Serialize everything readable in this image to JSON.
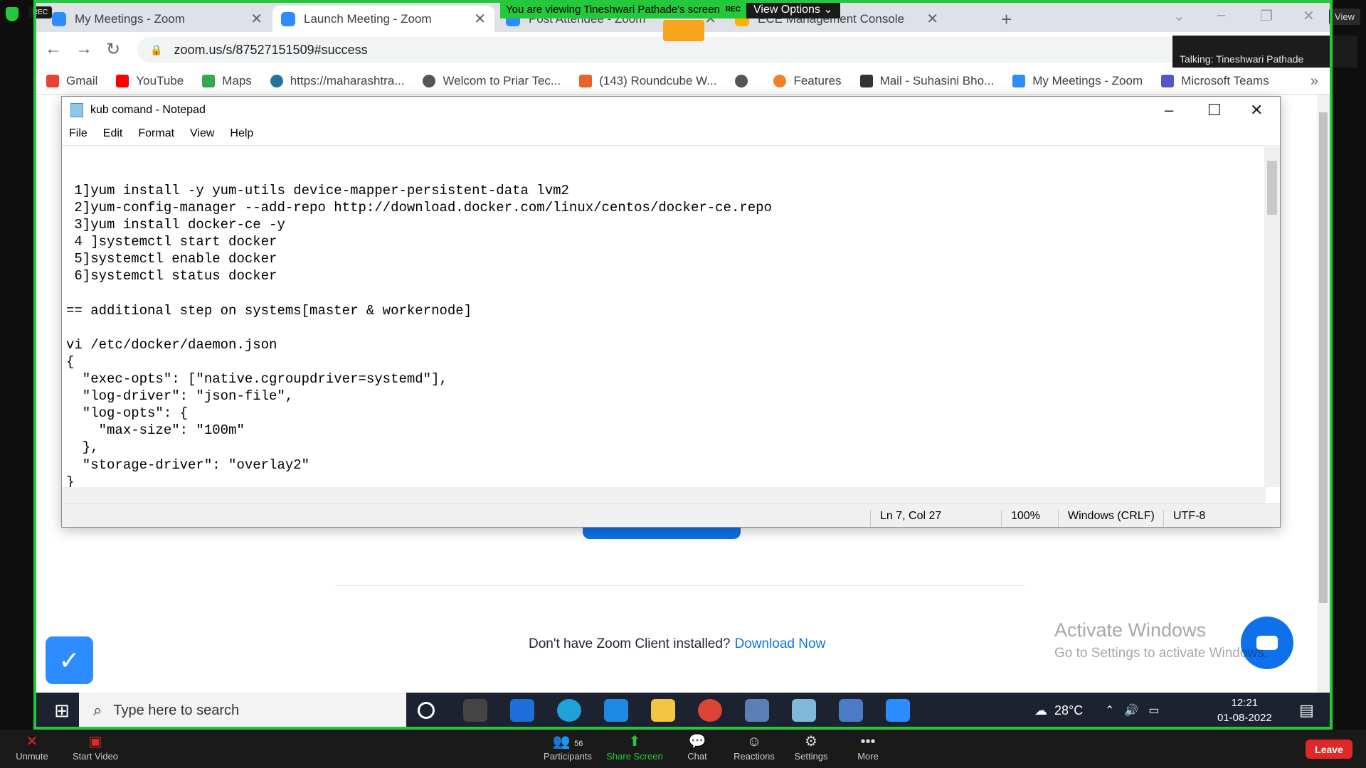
{
  "zoom_share": {
    "banner_text": "You are viewing Tineshwari Pathade's screen",
    "rec_label": "REC",
    "view_options_label": "View Options ⌄",
    "talking_text": "Talking: Tineshwari Pathade",
    "view_label": "View"
  },
  "browser": {
    "tabs": [
      {
        "title": "My Meetings - Zoom",
        "active": false
      },
      {
        "title": "Launch Meeting - Zoom",
        "active": true
      },
      {
        "title": "Post Attendee - Zoom",
        "active": false
      },
      {
        "title": "ECE Management Console",
        "active": false
      }
    ],
    "url": "zoom.us/s/87527151509#success",
    "bookmarks": [
      {
        "label": "Gmail",
        "color": "#ea4335"
      },
      {
        "label": "YouTube",
        "color": "#ff0000"
      },
      {
        "label": "Maps",
        "color": "#34a853"
      },
      {
        "label": "https://maharashtra...",
        "color": "#21759b"
      },
      {
        "label": "Welcom to Priar Tec...",
        "color": "#555555"
      },
      {
        "label": "(143) Roundcube W...",
        "color": "#e8632b"
      },
      {
        "label": "",
        "color": "#555555"
      },
      {
        "label": "Features",
        "color": "#f48024"
      },
      {
        "label": "Mail - Suhasini Bho...",
        "color": "#333333"
      },
      {
        "label": "My Meetings - Zoom",
        "color": "#2d8cff"
      },
      {
        "label": "Microsoft Teams",
        "color": "#5059c9"
      }
    ]
  },
  "page": {
    "no_client_text": "Don't have Zoom Client installed?",
    "download_link": "Download Now",
    "activate_title": "Activate Windows",
    "activate_sub": "Go to Settings to activate Windows."
  },
  "notepad": {
    "title": "kub comand - Notepad",
    "menu": [
      "File",
      "Edit",
      "Format",
      "View",
      "Help"
    ],
    "content": " 1]yum install -y yum-utils device-mapper-persistent-data lvm2\n 2]yum-config-manager --add-repo http://download.docker.com/linux/centos/docker-ce.repo\n 3]yum install docker-ce -y\n 4 ]systemctl start docker\n 5]systemctl enable docker\n 6]systemctl status docker\n\n== additional step on systems[master & workernode]\n\nvi /etc/docker/daemon.json\n{\n  \"exec-opts\": [\"native.cgroupdriver=systemd\"],\n  \"log-driver\": \"json-file\",\n  \"log-opts\": {\n    \"max-size\": \"100m\"\n  },\n  \"storage-driver\": \"overlay2\"\n}",
    "status": {
      "position": "Ln 7, Col 27",
      "zoom": "100%",
      "line_ending": "Windows (CRLF)",
      "encoding": "UTF-8"
    }
  },
  "taskbar": {
    "search_placeholder": "Type here to search",
    "temperature": "28°C",
    "time": "12:21",
    "date": "01-08-2022"
  },
  "zoom_controls": {
    "unmute": "Unmute",
    "start_video": "Start Video",
    "participants": "Participants",
    "participants_count": "56",
    "share_screen": "Share Screen",
    "chat": "Chat",
    "reactions": "Reactions",
    "settings": "Settings",
    "more": "More",
    "leave": "Leave"
  }
}
